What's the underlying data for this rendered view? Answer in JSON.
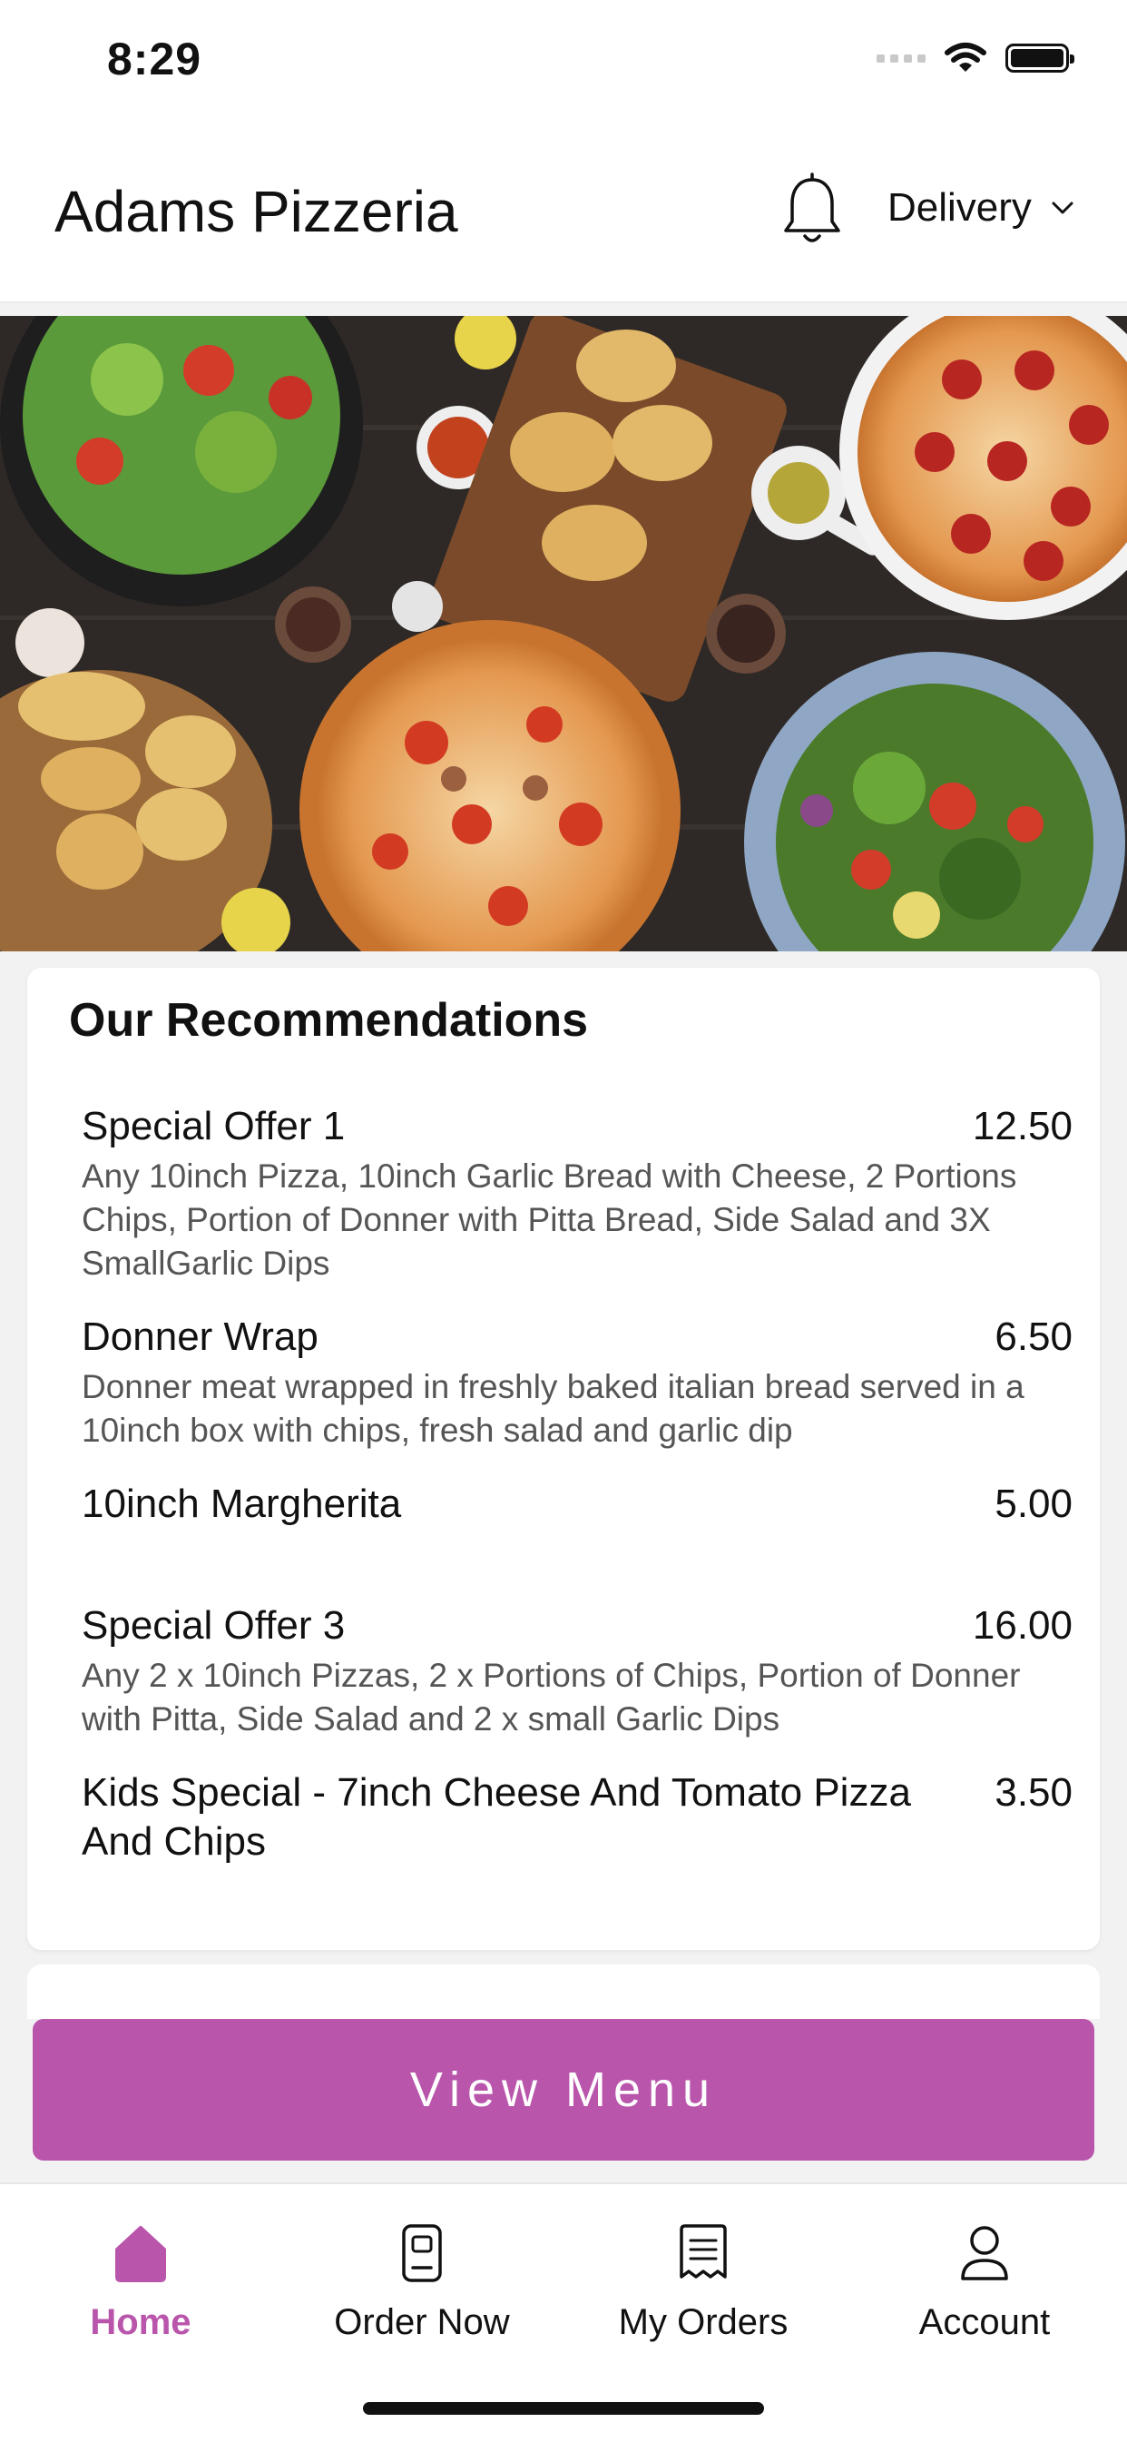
{
  "status_bar": {
    "time": "8:29"
  },
  "header": {
    "title": "Adams Pizzeria",
    "mode": "Delivery"
  },
  "recommendations": {
    "title": "Our Recommendations",
    "items": [
      {
        "name": "Special Offer 1",
        "price": "12.50",
        "description": "Any 10inch Pizza, 10inch Garlic Bread with Cheese, 2 Portions Chips, Portion of Donner with Pitta Bread, Side Salad and 3X SmallGarlic Dips"
      },
      {
        "name": "Donner Wrap",
        "price": "6.50",
        "description": "Donner meat wrapped in freshly baked italian bread served in a 10inch box with chips, fresh salad and garlic dip"
      },
      {
        "name": "10inch Margherita",
        "price": "5.00",
        "description": ""
      },
      {
        "name": "Special Offer 3",
        "price": "16.00",
        "description": "Any 2 x 10inch Pizzas, 2 x Portions of Chips, Portion of Donner with Pitta, Side Salad and 2 x small Garlic Dips"
      },
      {
        "name": "Kids Special - 7inch Cheese And Tomato Pizza And Chips",
        "price": "3.50",
        "description": ""
      }
    ]
  },
  "cta": {
    "label": "View Menu"
  },
  "tabbar": {
    "tabs": [
      {
        "label": "Home",
        "icon": "home-icon",
        "active": true
      },
      {
        "label": "Order Now",
        "icon": "order-icon",
        "active": false
      },
      {
        "label": "My Orders",
        "icon": "receipt-icon",
        "active": false
      },
      {
        "label": "Account",
        "icon": "user-icon",
        "active": false
      }
    ]
  },
  "colors": {
    "accent": "#b956ac"
  }
}
